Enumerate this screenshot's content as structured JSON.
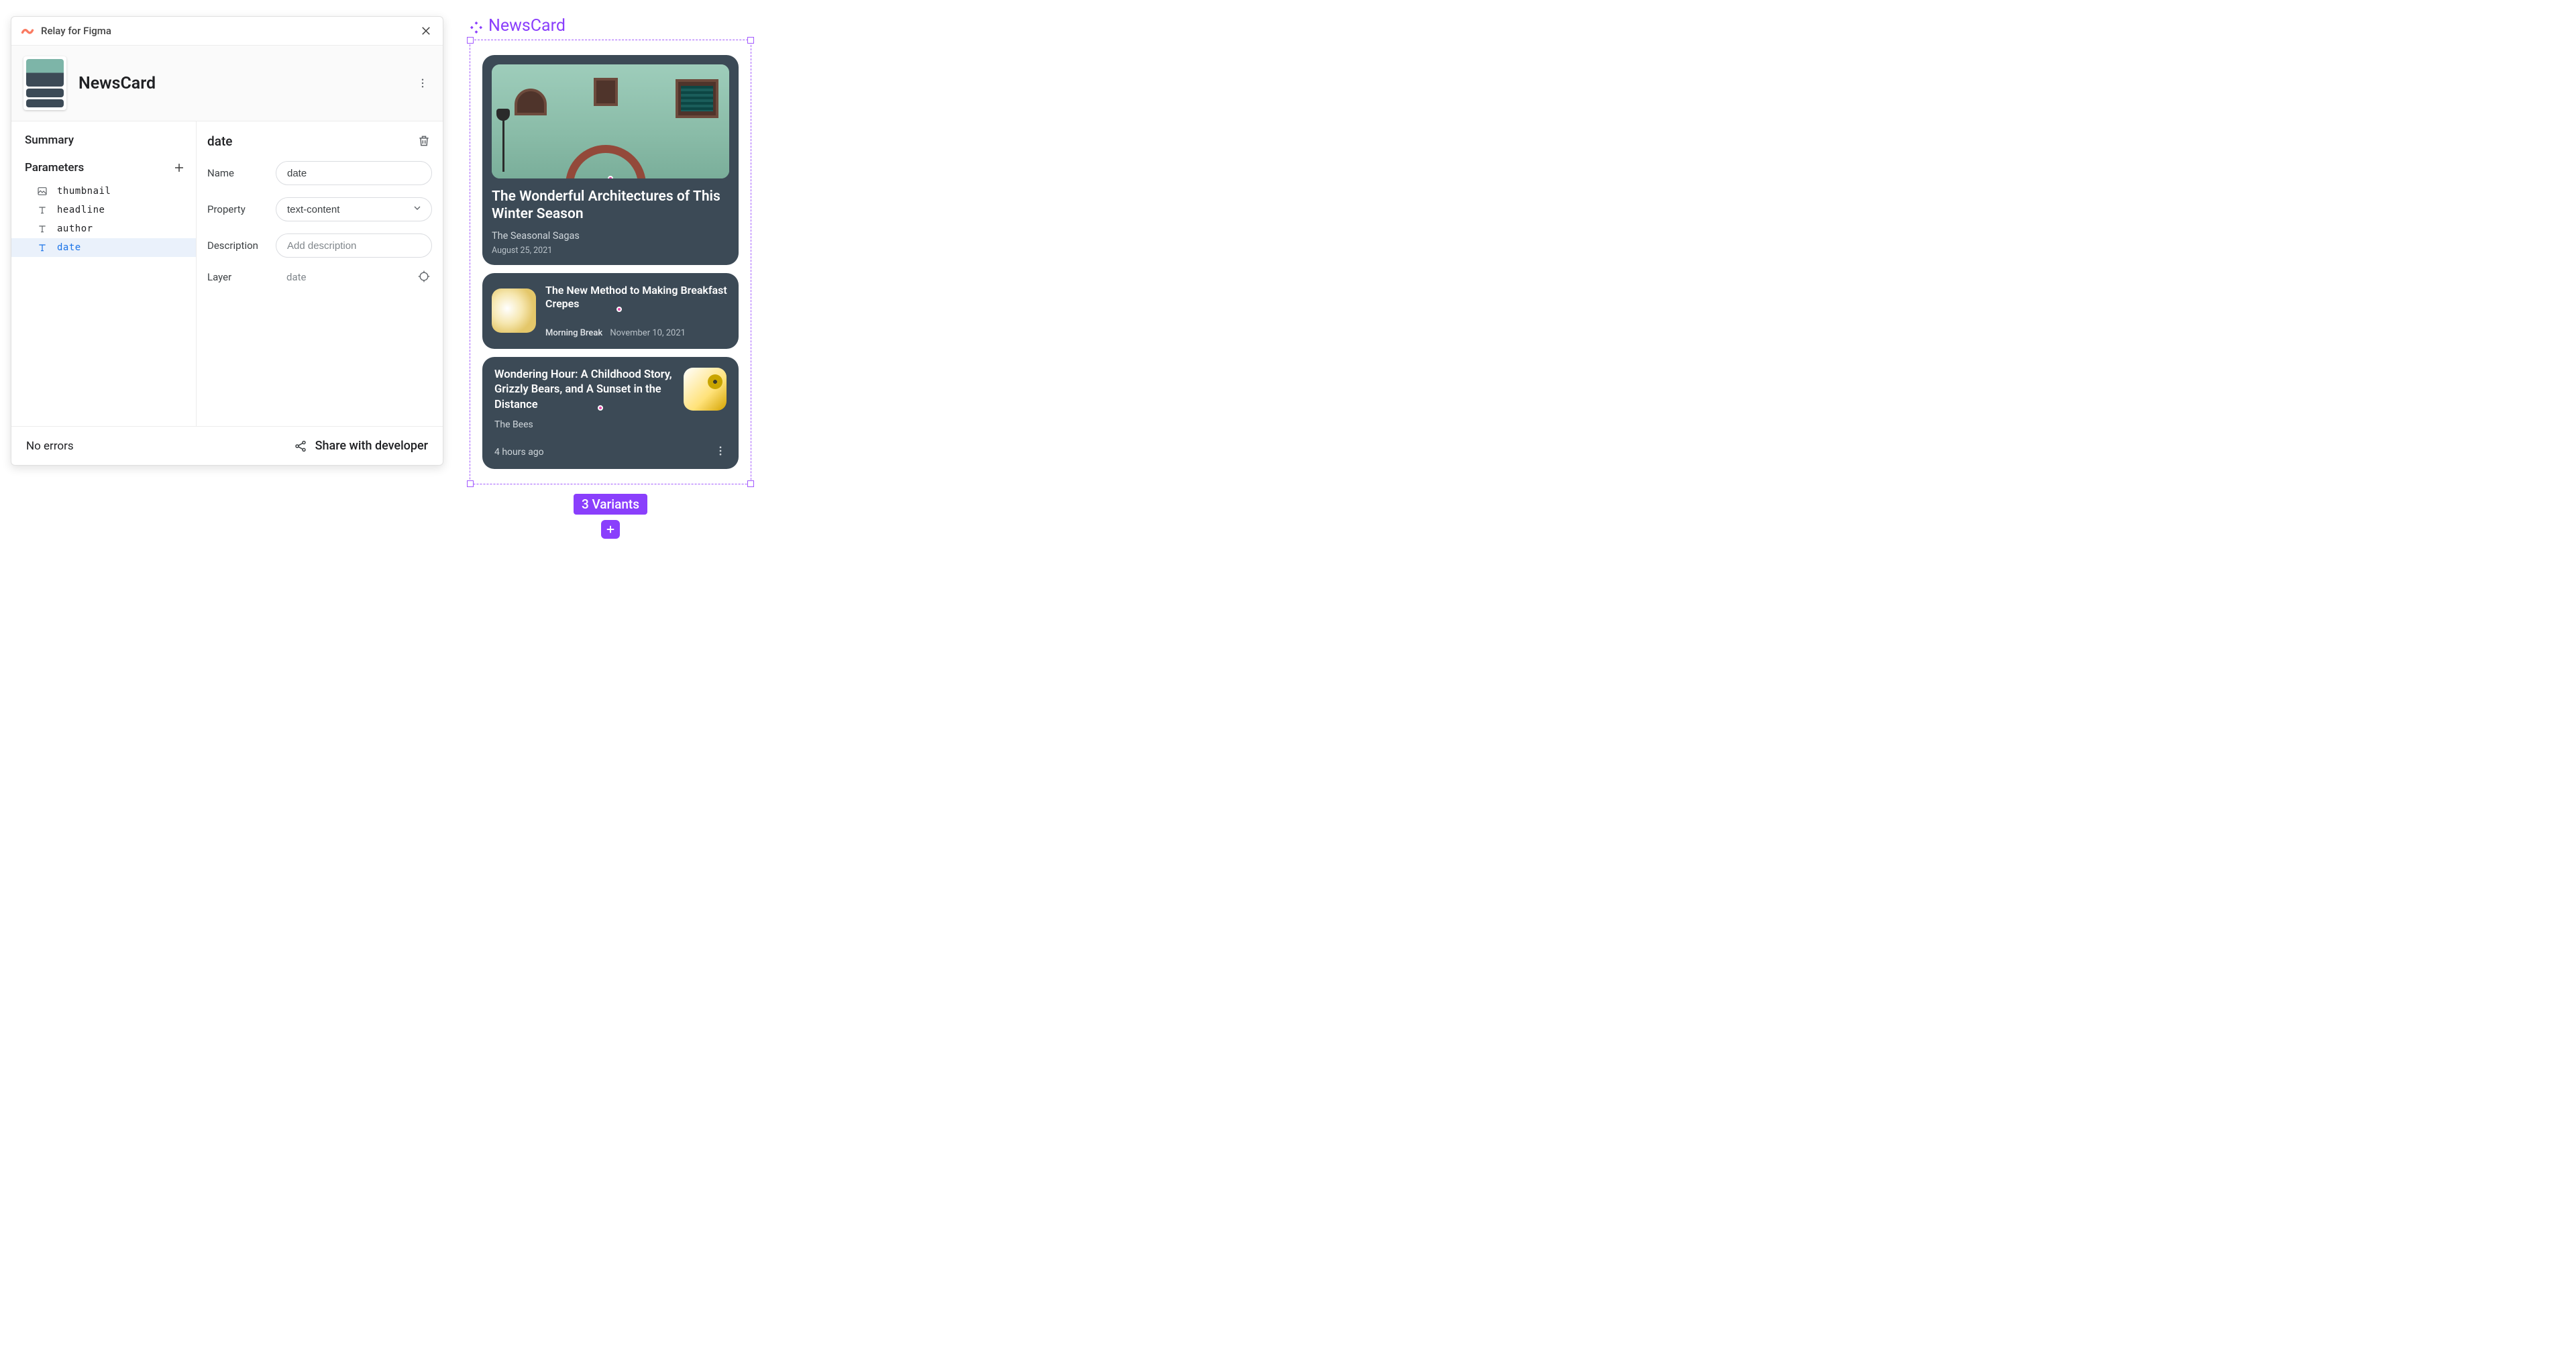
{
  "plugin": {
    "title": "Relay for Figma",
    "component_name": "NewsCard",
    "sidebar": {
      "summary": "Summary",
      "parameters_header": "Parameters",
      "parameters": [
        {
          "name": "thumbnail",
          "kind": "image"
        },
        {
          "name": "headline",
          "kind": "text"
        },
        {
          "name": "author",
          "kind": "text"
        },
        {
          "name": "date",
          "kind": "text"
        }
      ],
      "selected_index": 3
    },
    "detail": {
      "title": "date",
      "fields": {
        "name_label": "Name",
        "name_value": "date",
        "property_label": "Property",
        "property_value": "text-content",
        "description_label": "Description",
        "description_placeholder": "Add description",
        "layer_label": "Layer",
        "layer_value": "date"
      }
    },
    "footer": {
      "status": "No errors",
      "share": "Share with developer"
    }
  },
  "canvas": {
    "label": "NewsCard",
    "variants_badge": "3 Variants",
    "cards": [
      {
        "headline": "The Wonderful Architectures of This Winter Season",
        "author": "The Seasonal Sagas",
        "date": "August 25, 2021"
      },
      {
        "headline": "The New Method to Making Breakfast Crepes",
        "author": "Morning Break",
        "date": "November 10, 2021"
      },
      {
        "headline": "Wondering Hour: A Childhood Story, Grizzly Bears, and A Sunset in the Distance",
        "author": "The Bees",
        "date": "4 hours ago"
      }
    ]
  }
}
